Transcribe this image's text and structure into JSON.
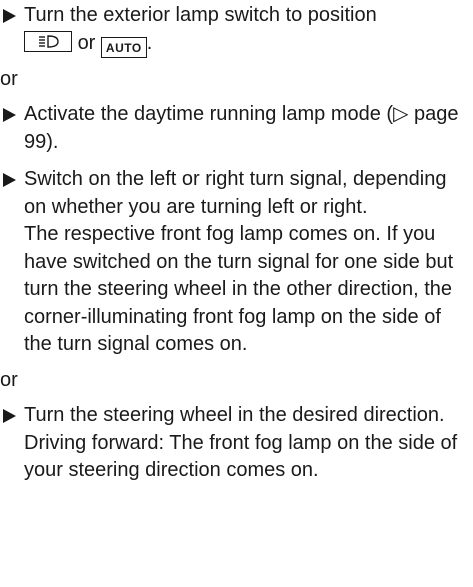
{
  "steps": [
    {
      "text_before": "Turn the exterior lamp switch to position",
      "symbol1_icon": "low-beam-headlamp-icon",
      "joiner": "or",
      "symbol2_label": "AUTO",
      "text_after": "."
    },
    {
      "text": "Activate the daytime running lamp mode (▷ page 99)."
    },
    {
      "text": "Switch on the left or right turn signal, depending on whether you are turning left or right.",
      "result": "The respective front fog lamp comes on. If you have switched on the turn signal for one side but turn the steering wheel in the other direction, the corner-illuminating front fog lamp on the side of the turn signal comes on."
    },
    {
      "text": "Turn the steering wheel in the desired direction.",
      "result": "Driving forward: The front fog lamp on the side of your steering direction comes on."
    }
  ],
  "or_labels": [
    "or",
    "or"
  ]
}
